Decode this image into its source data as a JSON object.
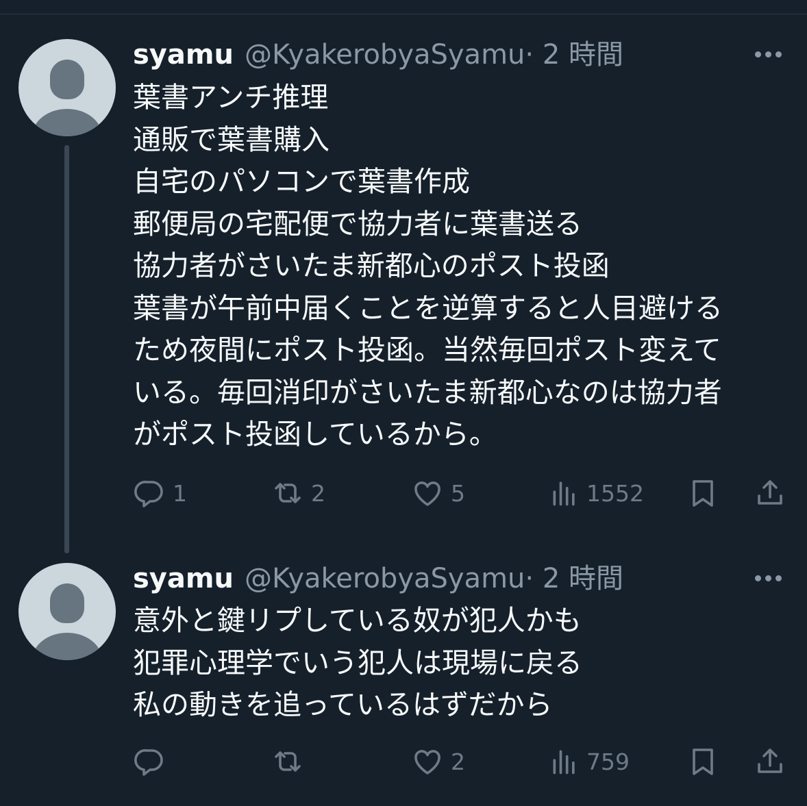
{
  "tweets": [
    {
      "name": "syamu",
      "handle": "@KyakerobyaSyamu",
      "time": "· 2 時間",
      "lines": [
        "葉書アンチ推理",
        "通販で葉書購入",
        "自宅のパソコンで葉書作成",
        "郵便局の宅配便で協力者に葉書送る",
        "協力者がさいたま新都心のポスト投函",
        "葉書が午前中届くことを逆算すると人目避ける",
        "ため夜間にポスト投函。当然毎回ポスト変えて",
        "いる。毎回消印がさいたま新都心なのは協力者",
        "がポスト投函しているから。"
      ],
      "replies": "1",
      "retweets": "2",
      "likes": "5",
      "views": "1552"
    },
    {
      "name": "syamu",
      "handle": "@KyakerobyaSyamu",
      "time": "· 2 時間",
      "lines": [
        "意外と鍵リプしている奴が犯人かも",
        "犯罪心理学でいう犯人は現場に戻る",
        "私の動きを追っているはずだから"
      ],
      "replies": "",
      "retweets": "",
      "likes": "2",
      "views": "759"
    }
  ],
  "icons": [
    "reply-icon",
    "retweet-icon",
    "like-icon",
    "views-icon",
    "bookmark-icon",
    "share-icon",
    "more-icon"
  ],
  "colors": {
    "background": "#15202b",
    "text": "#f7f9f9",
    "secondary": "#8b98a5",
    "icon": "#6e7b87",
    "thread_line": "#3a4753"
  }
}
